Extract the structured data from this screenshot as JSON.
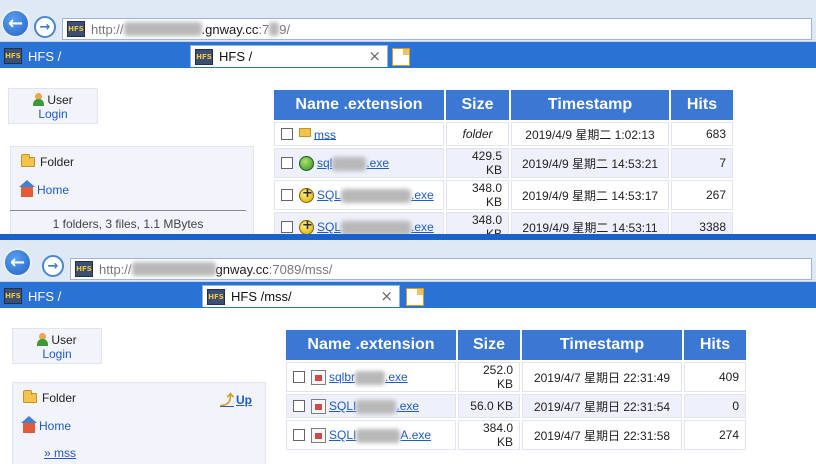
{
  "top": {
    "url": {
      "prefix": "http://",
      "host": ".gnway.cc",
      "port": ":7",
      "path": "9/"
    },
    "tabs": [
      {
        "icon": "HFS",
        "label": "HFS /"
      },
      {
        "icon": "HFS",
        "label": "HFS /",
        "close": "×"
      }
    ],
    "user": {
      "label": "User",
      "login": "Login"
    },
    "folder": {
      "label": "Folder",
      "home": "Home",
      "summary": "1 folders, 3 files, 1.1 MBytes"
    },
    "table": {
      "headers": [
        "Name .extension",
        "Size",
        "Timestamp",
        "Hits"
      ],
      "rows": [
        {
          "name": "mss",
          "size": "folder",
          "timestamp": "2019/4/9 星期二 1:02:13",
          "hits": "683"
        },
        {
          "name_start": "sql",
          "name_end": ".exe",
          "size": "429.5 KB",
          "timestamp": "2019/4/9 星期二 14:53:21",
          "hits": "7"
        },
        {
          "name_start": "SQL",
          "name_end": ".exe",
          "size": "348.0 KB",
          "timestamp": "2019/4/9 星期二 14:53:17",
          "hits": "267"
        },
        {
          "name_start": "SQL",
          "name_end": ".exe",
          "size": "348.0 KB",
          "timestamp": "2019/4/9 星期二 14:53:11",
          "hits": "3388"
        }
      ]
    }
  },
  "bottom": {
    "url": {
      "prefix": "http://",
      "host": "gnway.cc",
      "port": ":7089",
      "path": "/mss/"
    },
    "tabs": [
      {
        "icon": "HFS",
        "label": "HFS /"
      },
      {
        "icon": "HFS",
        "label": "HFS /mss/",
        "close": "×"
      }
    ],
    "user": {
      "label": "User",
      "login": "Login"
    },
    "folder": {
      "label": "Folder",
      "up": "Up",
      "home": "Home",
      "sub": "» mss"
    },
    "table": {
      "headers": [
        "Name .extension",
        "Size",
        "Timestamp",
        "Hits"
      ],
      "rows": [
        {
          "name_start": "sqlbr",
          "name_end": ".exe",
          "size": "252.0 KB",
          "timestamp": "2019/4/7 星期日 22:31:49",
          "hits": "409"
        },
        {
          "name_start": "SQLI",
          "name_end": ".exe",
          "size": "56.0 KB",
          "timestamp": "2019/4/7 星期日 22:31:54",
          "hits": "0"
        },
        {
          "name_start": "SQLI",
          "name_end": "A.exe",
          "size": "384.0 KB",
          "timestamp": "2019/4/7 星期日 22:31:58",
          "hits": "274"
        }
      ]
    }
  }
}
